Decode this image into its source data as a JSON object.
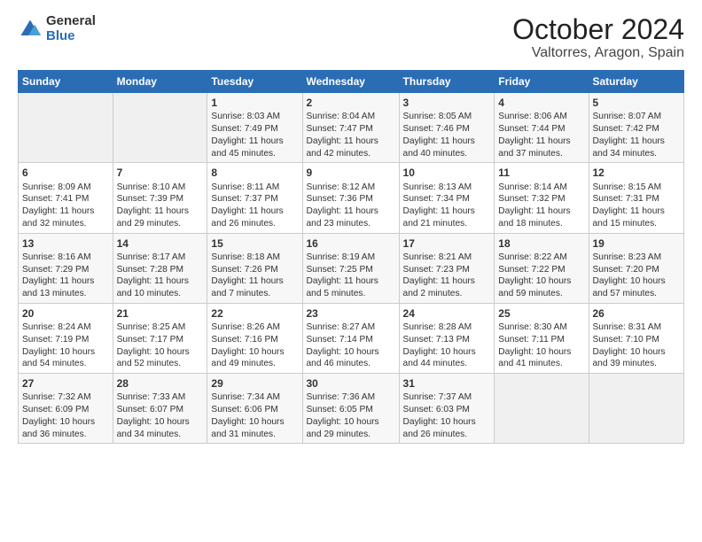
{
  "logo": {
    "general": "General",
    "blue": "Blue"
  },
  "header": {
    "month": "October 2024",
    "location": "Valtorres, Aragon, Spain"
  },
  "weekdays": [
    "Sunday",
    "Monday",
    "Tuesday",
    "Wednesday",
    "Thursday",
    "Friday",
    "Saturday"
  ],
  "weeks": [
    [
      {
        "day": "",
        "info": ""
      },
      {
        "day": "",
        "info": ""
      },
      {
        "day": "1",
        "info": "Sunrise: 8:03 AM\nSunset: 7:49 PM\nDaylight: 11 hours and 45 minutes."
      },
      {
        "day": "2",
        "info": "Sunrise: 8:04 AM\nSunset: 7:47 PM\nDaylight: 11 hours and 42 minutes."
      },
      {
        "day": "3",
        "info": "Sunrise: 8:05 AM\nSunset: 7:46 PM\nDaylight: 11 hours and 40 minutes."
      },
      {
        "day": "4",
        "info": "Sunrise: 8:06 AM\nSunset: 7:44 PM\nDaylight: 11 hours and 37 minutes."
      },
      {
        "day": "5",
        "info": "Sunrise: 8:07 AM\nSunset: 7:42 PM\nDaylight: 11 hours and 34 minutes."
      }
    ],
    [
      {
        "day": "6",
        "info": "Sunrise: 8:09 AM\nSunset: 7:41 PM\nDaylight: 11 hours and 32 minutes."
      },
      {
        "day": "7",
        "info": "Sunrise: 8:10 AM\nSunset: 7:39 PM\nDaylight: 11 hours and 29 minutes."
      },
      {
        "day": "8",
        "info": "Sunrise: 8:11 AM\nSunset: 7:37 PM\nDaylight: 11 hours and 26 minutes."
      },
      {
        "day": "9",
        "info": "Sunrise: 8:12 AM\nSunset: 7:36 PM\nDaylight: 11 hours and 23 minutes."
      },
      {
        "day": "10",
        "info": "Sunrise: 8:13 AM\nSunset: 7:34 PM\nDaylight: 11 hours and 21 minutes."
      },
      {
        "day": "11",
        "info": "Sunrise: 8:14 AM\nSunset: 7:32 PM\nDaylight: 11 hours and 18 minutes."
      },
      {
        "day": "12",
        "info": "Sunrise: 8:15 AM\nSunset: 7:31 PM\nDaylight: 11 hours and 15 minutes."
      }
    ],
    [
      {
        "day": "13",
        "info": "Sunrise: 8:16 AM\nSunset: 7:29 PM\nDaylight: 11 hours and 13 minutes."
      },
      {
        "day": "14",
        "info": "Sunrise: 8:17 AM\nSunset: 7:28 PM\nDaylight: 11 hours and 10 minutes."
      },
      {
        "day": "15",
        "info": "Sunrise: 8:18 AM\nSunset: 7:26 PM\nDaylight: 11 hours and 7 minutes."
      },
      {
        "day": "16",
        "info": "Sunrise: 8:19 AM\nSunset: 7:25 PM\nDaylight: 11 hours and 5 minutes."
      },
      {
        "day": "17",
        "info": "Sunrise: 8:21 AM\nSunset: 7:23 PM\nDaylight: 11 hours and 2 minutes."
      },
      {
        "day": "18",
        "info": "Sunrise: 8:22 AM\nSunset: 7:22 PM\nDaylight: 10 hours and 59 minutes."
      },
      {
        "day": "19",
        "info": "Sunrise: 8:23 AM\nSunset: 7:20 PM\nDaylight: 10 hours and 57 minutes."
      }
    ],
    [
      {
        "day": "20",
        "info": "Sunrise: 8:24 AM\nSunset: 7:19 PM\nDaylight: 10 hours and 54 minutes."
      },
      {
        "day": "21",
        "info": "Sunrise: 8:25 AM\nSunset: 7:17 PM\nDaylight: 10 hours and 52 minutes."
      },
      {
        "day": "22",
        "info": "Sunrise: 8:26 AM\nSunset: 7:16 PM\nDaylight: 10 hours and 49 minutes."
      },
      {
        "day": "23",
        "info": "Sunrise: 8:27 AM\nSunset: 7:14 PM\nDaylight: 10 hours and 46 minutes."
      },
      {
        "day": "24",
        "info": "Sunrise: 8:28 AM\nSunset: 7:13 PM\nDaylight: 10 hours and 44 minutes."
      },
      {
        "day": "25",
        "info": "Sunrise: 8:30 AM\nSunset: 7:11 PM\nDaylight: 10 hours and 41 minutes."
      },
      {
        "day": "26",
        "info": "Sunrise: 8:31 AM\nSunset: 7:10 PM\nDaylight: 10 hours and 39 minutes."
      }
    ],
    [
      {
        "day": "27",
        "info": "Sunrise: 7:32 AM\nSunset: 6:09 PM\nDaylight: 10 hours and 36 minutes."
      },
      {
        "day": "28",
        "info": "Sunrise: 7:33 AM\nSunset: 6:07 PM\nDaylight: 10 hours and 34 minutes."
      },
      {
        "day": "29",
        "info": "Sunrise: 7:34 AM\nSunset: 6:06 PM\nDaylight: 10 hours and 31 minutes."
      },
      {
        "day": "30",
        "info": "Sunrise: 7:36 AM\nSunset: 6:05 PM\nDaylight: 10 hours and 29 minutes."
      },
      {
        "day": "31",
        "info": "Sunrise: 7:37 AM\nSunset: 6:03 PM\nDaylight: 10 hours and 26 minutes."
      },
      {
        "day": "",
        "info": ""
      },
      {
        "day": "",
        "info": ""
      }
    ]
  ]
}
